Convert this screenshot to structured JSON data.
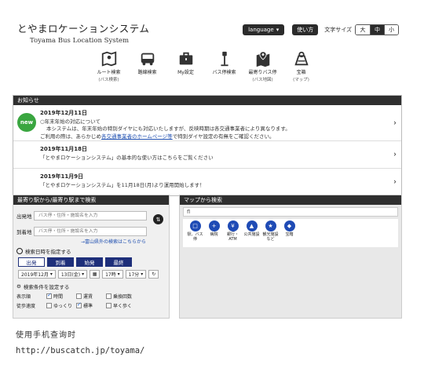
{
  "header": {
    "title_jp": "とやまロケーションシステム",
    "title_en": "Toyama Bus Location System",
    "language_label": "language",
    "howto_label": "使い方",
    "font_size_label": "文字サイズ",
    "font_sizes": [
      "大",
      "中",
      "小"
    ],
    "font_size_selected": "中"
  },
  "nav": [
    {
      "label": "ルート検索",
      "sub": "(バス検索)",
      "icon": "map-route-icon"
    },
    {
      "label": "路線検索",
      "sub": "",
      "icon": "bus-icon"
    },
    {
      "label": "My設定",
      "sub": "",
      "icon": "briefcase-icon"
    },
    {
      "label": "バス停検索",
      "sub": "",
      "icon": "bus-stop-icon"
    },
    {
      "label": "最寄りバス停",
      "sub": "(バス地図)",
      "icon": "map-pin-icon"
    },
    {
      "label": "宝箱",
      "sub": "(マップ)",
      "icon": "treasure-map-icon"
    }
  ],
  "notice": {
    "title": "お知らせ",
    "badge": "new",
    "items": [
      {
        "date": "2019年12月11日",
        "line1": "○年末年始の対応について",
        "line2": "本システムは、年末年始の特別ダイヤにも対応いたしますが、反映時期は各交通事業者により異なります。",
        "line3_pre": "ご利用の際は、あらかじめ",
        "line3_link": "各交通事業者のホームページ等",
        "line3_post": "で特別ダイヤ設定の有無をご確認ください。"
      },
      {
        "date": "2019年11月18日",
        "line1": "「とやまロケーションシステム」の基本的な使い方はこちらをご覧ください"
      },
      {
        "date": "2019年11月9日",
        "line1": "「とやまロケーションシステム」を11月18日(月)より運用開始します！"
      }
    ]
  },
  "search": {
    "title": "最寄り駅から/最寄り駅まで検索",
    "from_label": "出発地",
    "to_label": "到着地",
    "placeholder": "バス停・住所・施設名を入力",
    "outside_link": "→富山県外の検索はこちらから",
    "date_label": "検索日時を指定する",
    "modes": [
      "出発",
      "到着",
      "始発",
      "最終"
    ],
    "mode_selected": "出発",
    "year_month": "2019年12月",
    "day": "13日(金)",
    "hour": "17時",
    "minute": "17分",
    "cond_label": "検索条件を設定する",
    "display_order_label": "表示順",
    "display_opts": [
      {
        "label": "時間",
        "checked": true
      },
      {
        "label": "運賃",
        "checked": false
      },
      {
        "label": "乗換回数",
        "checked": false
      }
    ],
    "walk_label": "徒歩速度",
    "walk_opts": [
      {
        "label": "ゆっくり",
        "checked": false
      },
      {
        "label": "標準",
        "checked": true
      },
      {
        "label": "早く歩く",
        "checked": false
      }
    ]
  },
  "map": {
    "title": "マップから検索",
    "search_value": "fl",
    "categories": [
      {
        "label": "駅、バス停",
        "icon": "bus-stop-icon"
      },
      {
        "label": "病院",
        "icon": "hospital-icon"
      },
      {
        "label": "銀行・ATM",
        "icon": "bank-icon"
      },
      {
        "label": "公共施設",
        "icon": "public-facility-icon"
      },
      {
        "label": "観光施設など",
        "icon": "sightseeing-icon"
      },
      {
        "label": "宝箱",
        "icon": "treasure-icon"
      }
    ]
  },
  "caption": {
    "line1": "使用手机查询时",
    "line2": "http://buscatch.jp/toyama/"
  }
}
